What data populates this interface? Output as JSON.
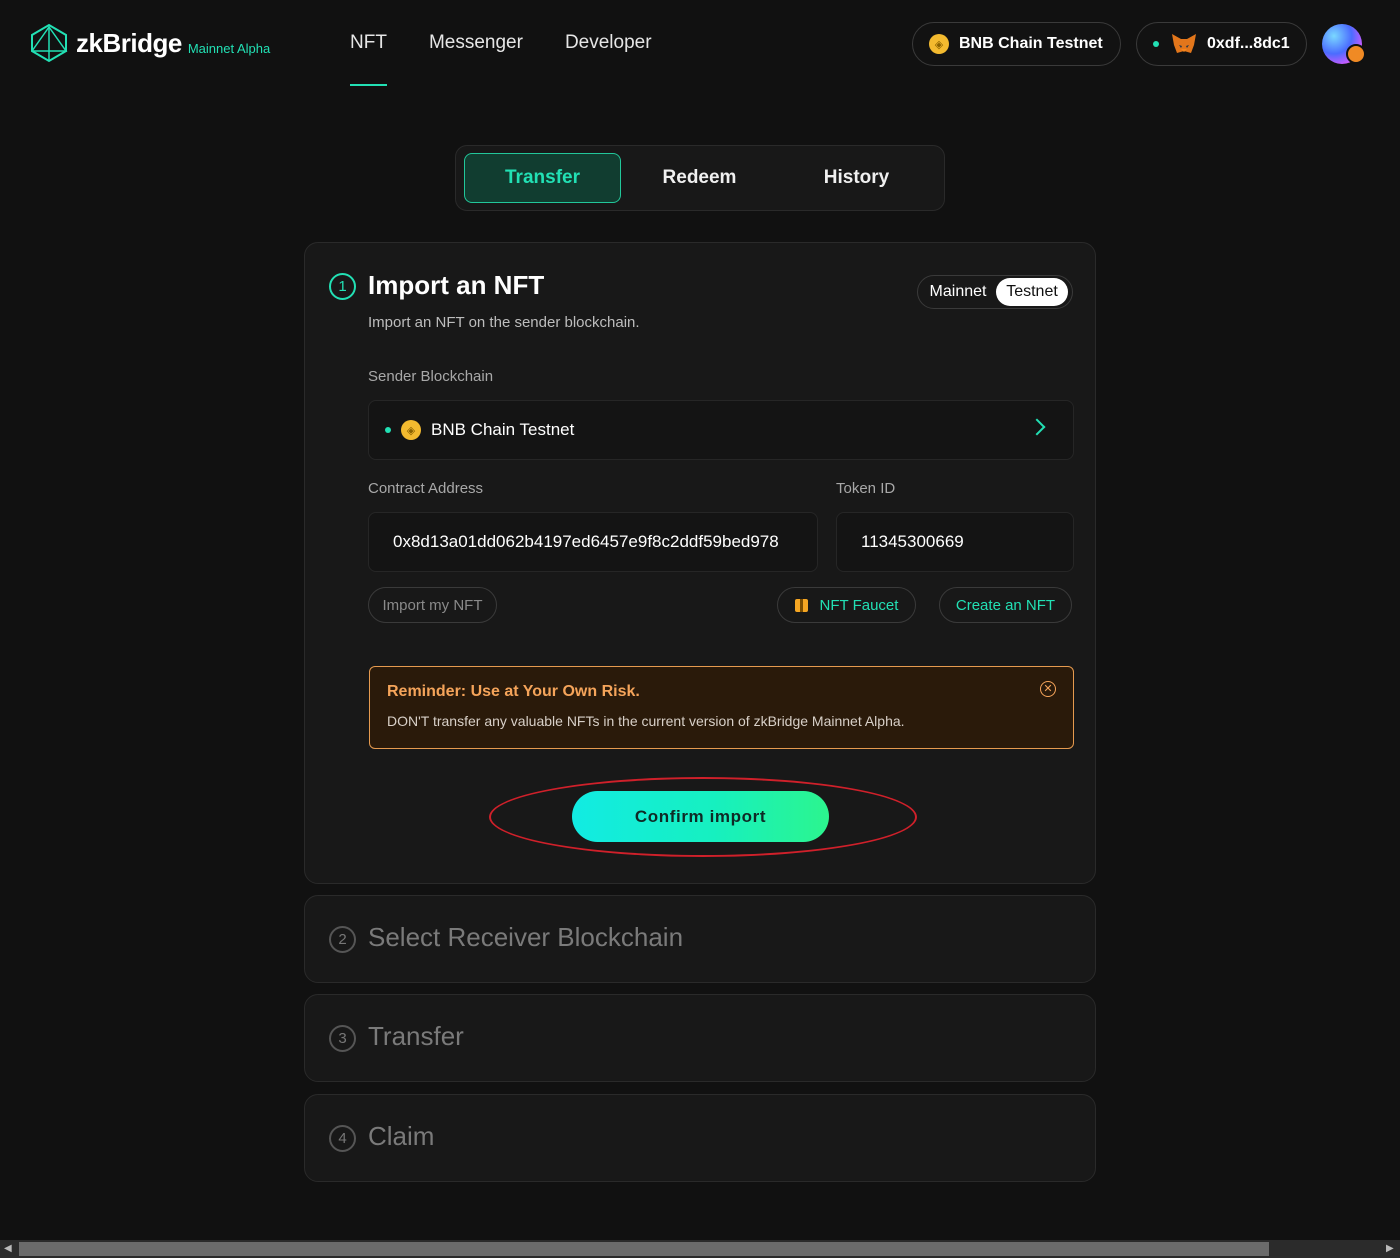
{
  "header": {
    "logo_text": "zkBridge",
    "logo_sub": "Mainnet Alpha",
    "nav": [
      "NFT",
      "Messenger",
      "Developer"
    ],
    "active_nav": "NFT",
    "chain_pill": "BNB Chain Testnet",
    "wallet_pill": "0xdf...8dc1"
  },
  "tabs": [
    "Transfer",
    "Redeem",
    "History"
  ],
  "active_tab": "Transfer",
  "import_card": {
    "step": "1",
    "title": "Import an NFT",
    "subtitle": "Import an NFT on the sender blockchain.",
    "network_toggle": {
      "mainnet": "Mainnet",
      "testnet": "Testnet",
      "selected": "Testnet"
    },
    "sender_label": "Sender Blockchain",
    "sender_value": "BNB Chain Testnet",
    "contract_label": "Contract Address",
    "contract_value": "0x8d13a01dd062b4197ed6457e9f8c2ddf59bed978",
    "token_label": "Token ID",
    "token_value": "11345300669",
    "import_my_nft": "Import my NFT",
    "nft_faucet": "NFT Faucet",
    "create_nft": "Create an NFT",
    "reminder_title": "Reminder: Use at Your Own Risk.",
    "reminder_text": "DON'T transfer any valuable NFTs in the current version of zkBridge Mainnet Alpha.",
    "confirm_button": "Confirm import"
  },
  "steps": [
    {
      "num": "2",
      "title": "Select Receiver Blockchain"
    },
    {
      "num": "3",
      "title": "Transfer"
    },
    {
      "num": "4",
      "title": "Claim"
    }
  ],
  "colors": {
    "accent": "#22e0b4",
    "background": "#111111",
    "warning": "#f5a45a",
    "annotation": "#d0202a"
  }
}
